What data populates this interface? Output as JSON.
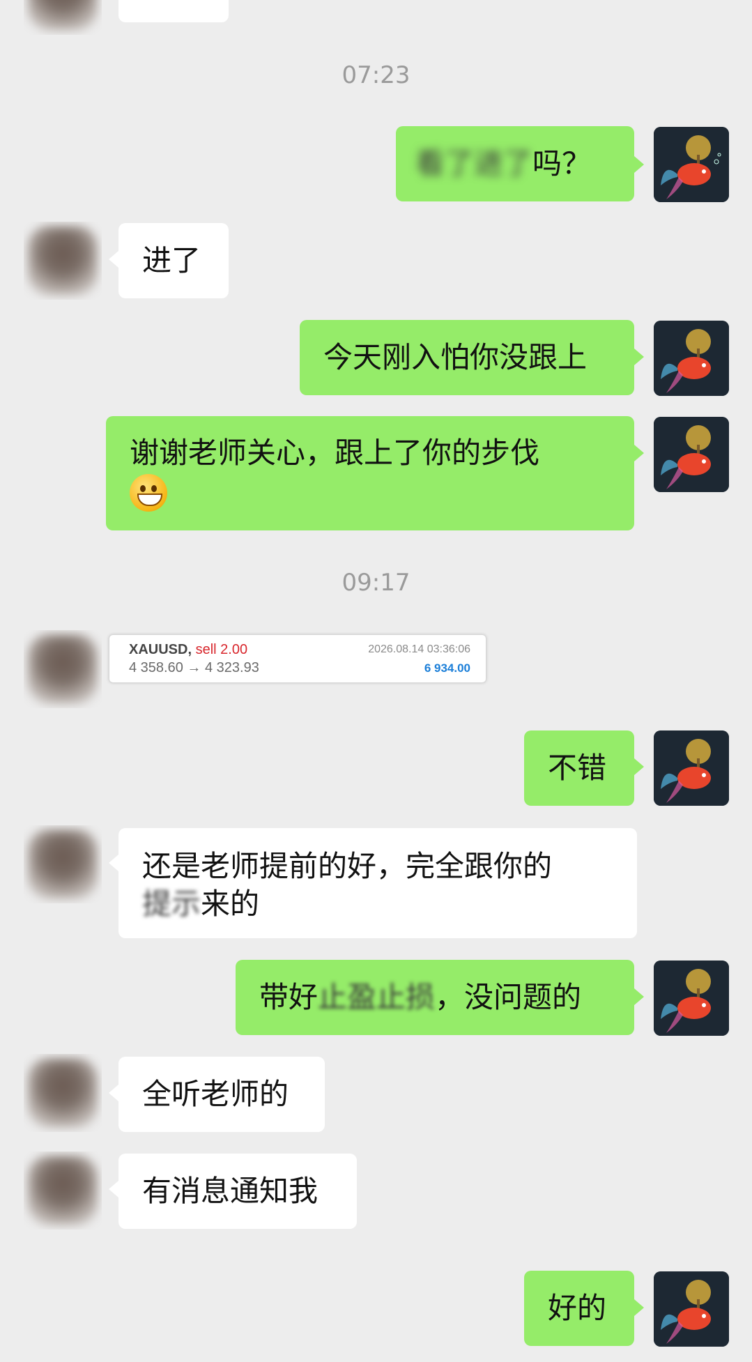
{
  "timestamps": [
    "07:23",
    "09:17"
  ],
  "messages": {
    "m1": {
      "sender": "me",
      "blurred_text": "看了进了",
      "text": "吗？"
    },
    "m2": {
      "sender": "other",
      "text": "进了"
    },
    "m3": {
      "sender": "me",
      "text": "今天刚入怕你没跟上"
    },
    "m4": {
      "sender": "me",
      "text": "谢谢老师关心，跟上了你的步伐",
      "emoji": "grinning-emoji"
    },
    "m5": {
      "sender": "other",
      "card": {
        "symbol": "XAUUSD,",
        "side": "sell 2.00",
        "prices": "4 358.60 → 4 323.93",
        "datetime": "2026.08.14 03:36:06",
        "profit": "6 934.00"
      }
    },
    "m6": {
      "sender": "me",
      "text": "不错"
    },
    "m7": {
      "sender": "other",
      "line1": "还是老师提前的好，完全跟你的",
      "line2_blurred": "提示",
      "line2": "来的"
    },
    "m8": {
      "sender": "me",
      "text_a": "带好",
      "text_blurred": "止盈止损",
      "text_b": "，没问题的"
    },
    "m9": {
      "sender": "other",
      "text": "全听老师的"
    },
    "m10": {
      "sender": "other",
      "text": "有消息通知我"
    },
    "m11": {
      "sender": "me",
      "text": "好的"
    }
  },
  "colors": {
    "background": "#ededed",
    "my_bubble": "#95ec69",
    "their_bubble": "#ffffff",
    "timestamp": "#9a9a9a",
    "sell_red": "#d8262c",
    "profit_blue": "#1a7ed8"
  }
}
